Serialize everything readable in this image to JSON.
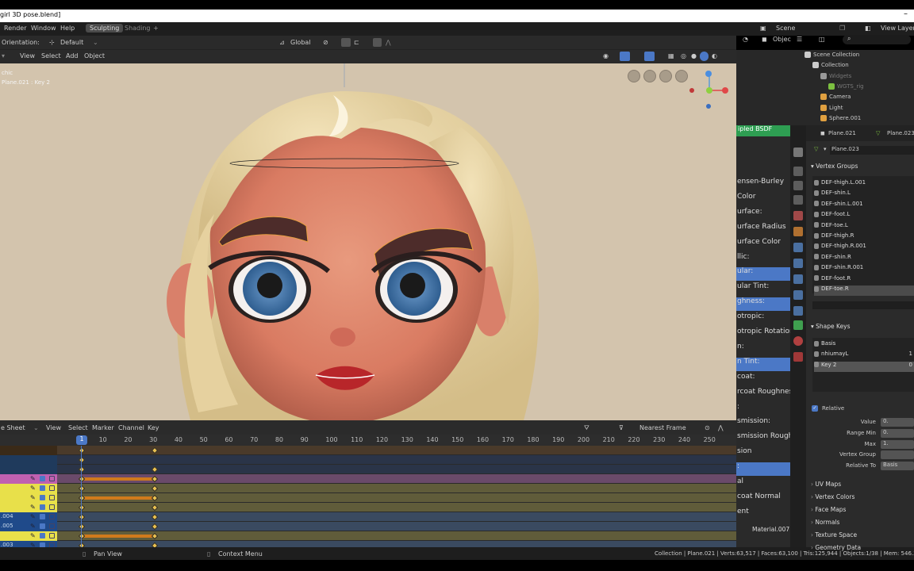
{
  "window": {
    "title": "girl 3D pose.blend]",
    "close": "–"
  },
  "menubar": {
    "items": [
      "Render",
      "Window",
      "Help"
    ],
    "workspaces": [
      "Sculpting",
      "Shading"
    ],
    "add_tab": "+",
    "scene": "Scene",
    "view_layer": "View Layer"
  },
  "toolbar": {
    "orientation_label": "Orientation:",
    "orientation_value": "Default",
    "transform_space": "Global"
  },
  "viewport_header": {
    "items": [
      "View",
      "Select",
      "Add",
      "Object"
    ]
  },
  "viewport": {
    "overlay_line1": "chic",
    "overlay_line2": "Plane.021 : Key 2"
  },
  "timeline": {
    "editor": "e Sheet",
    "menus": [
      "View",
      "Select",
      "Marker",
      "Channel",
      "Key"
    ],
    "snap": "Nearest Frame",
    "current_frame": "1",
    "ticks": [
      "10",
      "20",
      "30",
      "40",
      "50",
      "60",
      "70",
      "80",
      "90",
      "100",
      "110",
      "120",
      "130",
      "140",
      "150",
      "160",
      "170",
      "180",
      "190",
      "200",
      "210",
      "220",
      "230",
      "240",
      "250"
    ],
    "channel_labels": [
      "",
      "",
      "",
      "",
      "",
      "",
      "",
      ".004",
      ".005",
      "",
      ".003"
    ]
  },
  "statusbar": {
    "pan": "Pan View",
    "context": "Context Menu",
    "stats": "Collection | Plane.021 | Verts:63,517 | Faces:63,100 | Tris:125,944 | Objects:1/38 | Mem: 546.3"
  },
  "outliner": {
    "header": "Objec",
    "items": [
      {
        "label": "Scene Collection",
        "indent": 0
      },
      {
        "label": "Collection",
        "indent": 1
      },
      {
        "label": "Widgets",
        "indent": 2
      },
      {
        "label": "WGTS_rig",
        "indent": 3
      },
      {
        "label": "Camera",
        "indent": 2
      },
      {
        "label": "Light",
        "indent": 2
      },
      {
        "label": "Sphere.001",
        "indent": 2
      }
    ]
  },
  "material_panel": {
    "node_header": "ipled BSDF",
    "rows": [
      {
        "label": "ensen-Burley",
        "blue": false
      },
      {
        "label": "Color",
        "blue": false
      },
      {
        "label": "urface:",
        "blue": false
      },
      {
        "label": "urface Radius",
        "blue": false
      },
      {
        "label": "urface Color",
        "blue": false
      },
      {
        "label": "llic:",
        "blue": false
      },
      {
        "label": "ular:",
        "blue": true
      },
      {
        "label": "ular Tint:",
        "blue": false
      },
      {
        "label": "ghness:",
        "blue": true
      },
      {
        "label": "otropic:",
        "blue": false
      },
      {
        "label": "otropic Rotation",
        "blue": false
      },
      {
        "label": "n:",
        "blue": false
      },
      {
        "label": "n Tint:",
        "blue": true
      },
      {
        "label": "coat:",
        "blue": false
      },
      {
        "label": "rcoat Roughnes",
        "blue": false
      },
      {
        "label": ":",
        "blue": false
      },
      {
        "label": "smission:",
        "blue": false
      },
      {
        "label": "smission Rough",
        "blue": false
      },
      {
        "label": "sion",
        "blue": false
      },
      {
        "label": ":",
        "blue": true
      },
      {
        "label": "al",
        "blue": false
      },
      {
        "label": "coat Normal",
        "blue": false
      },
      {
        "label": "ent",
        "blue": false
      }
    ],
    "material": "Material.007"
  },
  "properties": {
    "object": "Plane.021",
    "mesh": "Plane.023",
    "data_name": "Plane.023",
    "vertex_groups_title": "Vertex Groups",
    "vertex_groups": [
      "DEF-thigh.L.001",
      "DEF-shin.L",
      "DEF-shin.L.001",
      "DEF-foot.L",
      "DEF-toe.L",
      "DEF-thigh.R",
      "DEF-thigh.R.001",
      "DEF-shin.R",
      "DEF-shin.R.001",
      "DEF-foot.R",
      "DEF-toe.R"
    ],
    "shape_keys_title": "Shape Keys",
    "shape_keys": [
      {
        "name": "Basis",
        "value": ""
      },
      {
        "name": "nhiumayL",
        "value": "1"
      },
      {
        "name": "Key 2",
        "value": "0"
      }
    ],
    "relative_label": "Relative",
    "fields": [
      {
        "label": "Value",
        "value": "0."
      },
      {
        "label": "Range Min",
        "value": "0."
      },
      {
        "label": "Max",
        "value": "1."
      },
      {
        "label": "Vertex Group",
        "value": ""
      },
      {
        "label": "Relative To",
        "value": "Basis"
      }
    ],
    "collapsed_sections": [
      "UV Maps",
      "Vertex Colors",
      "Face Maps",
      "Normals",
      "Texture Space",
      "Geometry Data"
    ]
  },
  "colors": {
    "viewport_bg": "#cfc0a9",
    "accent_blue": "#4b78c6",
    "keyframe": "#e8c050",
    "hold_bar": "#d07a1c",
    "channel_yellow": "#e8e04a",
    "channel_pink": "#c060b0"
  }
}
